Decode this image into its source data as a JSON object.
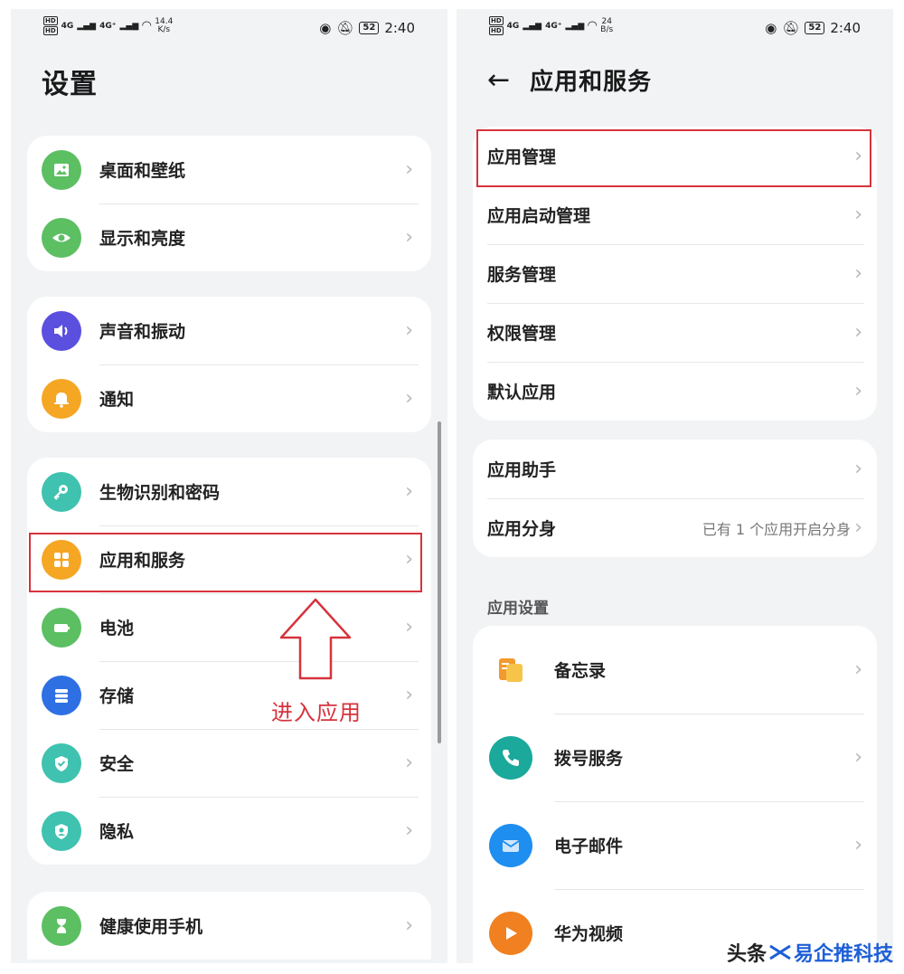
{
  "left": {
    "status": {
      "net1": "4G",
      "net2": "4G⁺",
      "speed_value": "14.4",
      "speed_unit": "K/s",
      "battery": "52",
      "time": "2:40"
    },
    "title": "设置",
    "groups": [
      [
        {
          "label": "桌面和壁纸",
          "icon": "wallpaper-icon",
          "color": "#5cbf62"
        },
        {
          "label": "显示和亮度",
          "icon": "eye-icon",
          "color": "#5cbf62"
        }
      ],
      [
        {
          "label": "声音和振动",
          "icon": "speaker-icon",
          "color": "#5b4fe0"
        },
        {
          "label": "通知",
          "icon": "bell-icon",
          "color": "#f5a623"
        }
      ],
      [
        {
          "label": "生物识别和密码",
          "icon": "key-icon",
          "color": "#3fc2b0"
        },
        {
          "label": "应用和服务",
          "icon": "apps-grid-icon",
          "color": "#f5a623"
        },
        {
          "label": "电池",
          "icon": "battery-icon",
          "color": "#5cbf62"
        },
        {
          "label": "存储",
          "icon": "storage-icon",
          "color": "#2f6fe4"
        },
        {
          "label": "安全",
          "icon": "shield-icon",
          "color": "#3fc2b0"
        },
        {
          "label": "隐私",
          "icon": "privacy-icon",
          "color": "#3fc2b0"
        }
      ],
      [
        {
          "label": "健康使用手机",
          "icon": "hourglass-icon",
          "color": "#5cbf62"
        }
      ]
    ],
    "callout": "进入应用"
  },
  "right": {
    "status": {
      "net1": "4G",
      "net2": "4G⁺",
      "speed_value": "24",
      "speed_unit": "B/s",
      "battery": "52",
      "time": "2:40"
    },
    "title": "应用和服务",
    "group1": [
      {
        "label": "应用管理"
      },
      {
        "label": "应用启动管理"
      },
      {
        "label": "服务管理"
      },
      {
        "label": "权限管理"
      },
      {
        "label": "默认应用"
      }
    ],
    "group2": [
      {
        "label": "应用助手",
        "value": ""
      },
      {
        "label": "应用分身",
        "value": "已有 1 个应用开启分身"
      }
    ],
    "section_label": "应用设置",
    "apps": [
      {
        "label": "备忘录",
        "icon": "memo-icon",
        "color": "#f29a2e"
      },
      {
        "label": "拨号服务",
        "icon": "phone-icon",
        "color": "#1aa99a"
      },
      {
        "label": "电子邮件",
        "icon": "mail-icon",
        "color": "#1e8ef0"
      },
      {
        "label": "华为视频",
        "icon": "video-play-icon",
        "color": "#f08020"
      }
    ]
  },
  "watermark": {
    "part1": "头条",
    "part2": "易企推科技"
  },
  "colors": {
    "highlight": "#d6333d",
    "background": "#f1f3f5",
    "card": "#ffffff"
  }
}
